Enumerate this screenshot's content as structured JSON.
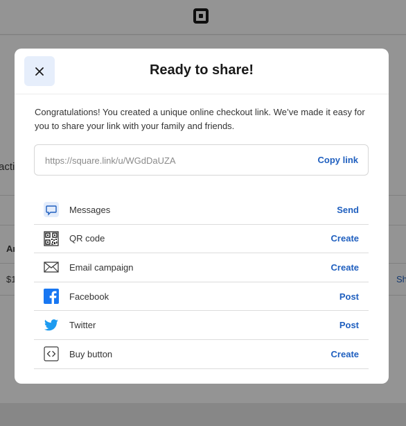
{
  "modal": {
    "title": "Ready to share!",
    "intro": "Congratulations! You created a unique online checkout link. We’ve made it easy for you to share your link with your family and friends.",
    "link": {
      "value": "https://square.link/u/WGdDaUZA",
      "copy_label": "Copy link"
    },
    "share_options": [
      {
        "icon": "message-bubble-icon",
        "label": "Messages",
        "action": "Send"
      },
      {
        "icon": "qr-code-icon",
        "label": "QR code",
        "action": "Create"
      },
      {
        "icon": "envelope-icon",
        "label": "Email campaign",
        "action": "Create"
      },
      {
        "icon": "facebook-icon",
        "label": "Facebook",
        "action": "Post"
      },
      {
        "icon": "twitter-icon",
        "label": "Twitter",
        "action": "Post"
      },
      {
        "icon": "code-brackets-icon",
        "label": "Buy button",
        "action": "Create"
      }
    ]
  },
  "background": {
    "fragments": [
      "acti",
      "Ar",
      "$1",
      "Sh"
    ]
  },
  "colors": {
    "accent": "#1f5fbf",
    "close_bg": "#e6eefb",
    "facebook": "#1877f2",
    "twitter": "#1d9bf0",
    "messages": "#1f5fbf"
  }
}
